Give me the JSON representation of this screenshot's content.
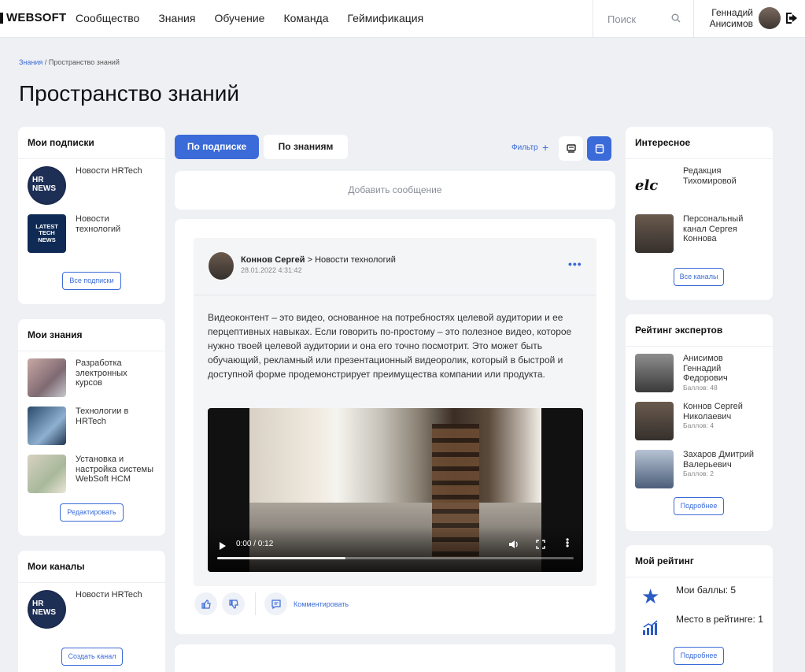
{
  "header": {
    "logo": "WEBSOFT",
    "nav": [
      "Сообщество",
      "Знания",
      "Обучение",
      "Команда",
      "Геймификация"
    ],
    "search_placeholder": "Поиск",
    "user_first": "Геннадий",
    "user_last": "Анисимов"
  },
  "breadcrumb": {
    "root": "Знания",
    "separator": "/",
    "current": "Пространство знаний"
  },
  "page_title": "Пространство знаний",
  "subscriptions": {
    "title": "Мои подписки",
    "items": [
      {
        "label": "Новости HRTech",
        "thumb_text": "HR NEWS"
      },
      {
        "label": "Новости технологий",
        "thumb_text": "LATEST TECH NEWS"
      }
    ],
    "button": "Все подписки"
  },
  "knowledge": {
    "title": "Мои знания",
    "items": [
      {
        "label": "Разработка электронных курсов"
      },
      {
        "label": "Технологии в HRTech"
      },
      {
        "label": "Установка и настройка системы WebSoft HCM"
      }
    ],
    "button": "Редактировать"
  },
  "channels": {
    "title": "Мои каналы",
    "items": [
      {
        "label": "Новости HRTech",
        "thumb_text": "HR NEWS"
      }
    ],
    "button": "Создать канал"
  },
  "feed": {
    "tabs": [
      "По подписке",
      "По знаниям"
    ],
    "filter_label": "Фильтр",
    "filter_plus": "+",
    "add_message": "Добавить сообщение"
  },
  "post": {
    "author": "Коннов Сергей",
    "arrow": ">",
    "channel": "Новости технологий",
    "date": "28.01.2022 4:31:42",
    "more": "•••",
    "text": "Видеоконтент – это видео, основанное на потребностях целевой аудитории и ее перцептивных навыках. Если говорить по-простому – это полезное видео, которое нужно твоей целевой аудитории и она его точно посмотрит. Это может быть обучающий, рекламный или презентационный видеоролик, который в быстрой и доступной форме продемонстрирует преимущества компании или продукта.",
    "video_time": "0:00 / 0:12",
    "video_progress": 0.36,
    "comment_label": "Комментировать"
  },
  "interesting": {
    "title": "Интересное",
    "items": [
      {
        "label": "Редакция Тихомировой",
        "logo_text": "elc"
      },
      {
        "label": "Персональный канал Сергея Коннова"
      }
    ],
    "button": "Все каналы"
  },
  "experts": {
    "title": "Рейтинг экспертов",
    "items": [
      {
        "name": "Анисимов Геннадий Федорович",
        "score": "Баллов: 48"
      },
      {
        "name": "Коннов Сергей Николаевич",
        "score": "Баллов: 4"
      },
      {
        "name": "Захаров Дмитрий Валерьевич",
        "score": "Баллов: 2"
      }
    ],
    "button": "Подробнее"
  },
  "my_rating": {
    "title": "Мой рейтинг",
    "points": "Мои баллы: 5",
    "place": "Место в рейтинге: 1",
    "button": "Подробнее"
  },
  "colors": {
    "accent": "#3b6bd8",
    "background": "#eef0f4"
  }
}
